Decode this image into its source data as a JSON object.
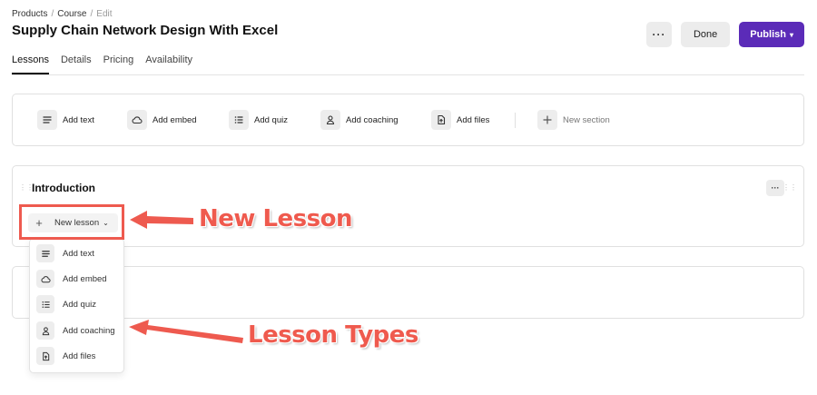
{
  "breadcrumb": {
    "item1": "Products",
    "sep1": "/",
    "item2": "Course",
    "sep2": "/",
    "current": "Edit"
  },
  "page_title": "Supply Chain Network Design With Excel",
  "header": {
    "more_label": "···",
    "done_label": "Done",
    "publish_label": "Publish",
    "publish_chevron": "▾"
  },
  "tabs": [
    {
      "label": "Lessons"
    },
    {
      "label": "Details"
    },
    {
      "label": "Pricing"
    },
    {
      "label": "Availability"
    }
  ],
  "toolbar": {
    "items": [
      {
        "label": "Add text",
        "icon": "text-lines-icon"
      },
      {
        "label": "Add embed",
        "icon": "cloud-icon"
      },
      {
        "label": "Add quiz",
        "icon": "list-icon"
      },
      {
        "label": "Add coaching",
        "icon": "person-icon"
      },
      {
        "label": "Add files",
        "icon": "file-upload-icon"
      },
      {
        "label": "New section",
        "icon": "plus-icon"
      }
    ]
  },
  "section": {
    "title": "Introduction",
    "more_label": "···"
  },
  "new_lesson": {
    "label": "New lesson",
    "plus": "+",
    "chevron": "⌄"
  },
  "dropdown": {
    "items": [
      {
        "label": "Add text",
        "icon": "text-lines-icon"
      },
      {
        "label": "Add embed",
        "icon": "cloud-icon"
      },
      {
        "label": "Add quiz",
        "icon": "list-icon"
      },
      {
        "label": "Add coaching",
        "icon": "person-icon"
      },
      {
        "label": "Add files",
        "icon": "file-upload-icon"
      }
    ]
  },
  "annotations": {
    "new_lesson": "New Lesson",
    "lesson_types": "Lesson Types",
    "color": "#ef5a4e"
  },
  "colors": {
    "publish": "#5b2bb8",
    "annotation": "#ee5a4f"
  }
}
